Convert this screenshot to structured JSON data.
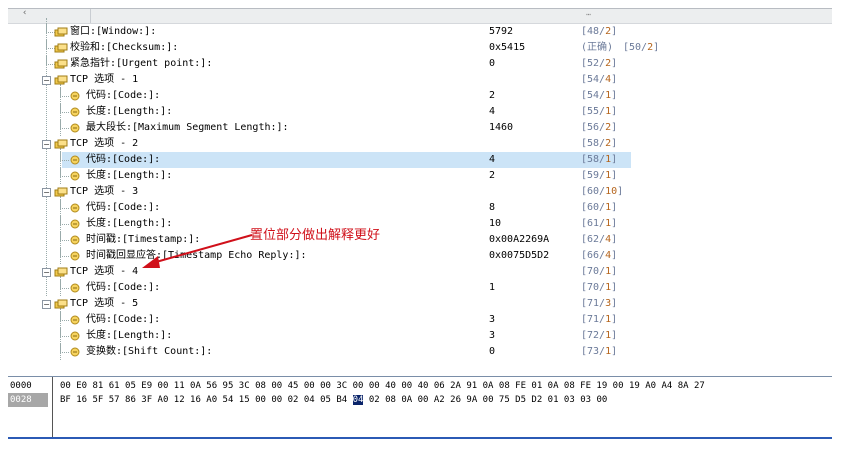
{
  "rows": [
    {
      "label": "窗口:[Window:]:",
      "value": "5792",
      "ref_pre": "[48/",
      "ref_num": "2",
      "ref_post": "]"
    },
    {
      "label": "校验和:[Checksum:]:",
      "value": "0x5415",
      "ref_pre": "(正确)",
      "ref_num": "",
      "ref_post": "",
      "ref2_pre": "[50/",
      "ref2_num": "2",
      "ref2_post": "]"
    },
    {
      "label": "紧急指针:[Urgent point:]:",
      "value": "0",
      "ref_pre": "[52/",
      "ref_num": "2",
      "ref_post": "]"
    },
    {
      "label": "TCP 选项 - 1",
      "value": "",
      "ref_pre": "[54/",
      "ref_num": "4",
      "ref_post": "]"
    },
    {
      "label": "代码:[Code:]:",
      "value": "2",
      "ref_pre": "[54/",
      "ref_num": "1",
      "ref_post": "]"
    },
    {
      "label": "长度:[Length:]:",
      "value": "4",
      "ref_pre": "[55/",
      "ref_num": "1",
      "ref_post": "]"
    },
    {
      "label": "最大段长:[Maximum Segment Length:]:",
      "value": "1460",
      "ref_pre": "[56/",
      "ref_num": "2",
      "ref_post": "]"
    },
    {
      "label": "TCP 选项 - 2",
      "value": "",
      "ref_pre": "[58/",
      "ref_num": "2",
      "ref_post": "]"
    },
    {
      "label": "代码:[Code:]:",
      "value": "4",
      "ref_pre": "[58/",
      "ref_num": "1",
      "ref_post": "]"
    },
    {
      "label": "长度:[Length:]:",
      "value": "2",
      "ref_pre": "[59/",
      "ref_num": "1",
      "ref_post": "]"
    },
    {
      "label": "TCP 选项 - 3",
      "value": "",
      "ref_pre": "[60/",
      "ref_num": "10",
      "ref_post": "]"
    },
    {
      "label": "代码:[Code:]:",
      "value": "8",
      "ref_pre": "[60/",
      "ref_num": "1",
      "ref_post": "]"
    },
    {
      "label": "长度:[Length:]:",
      "value": "10",
      "ref_pre": "[61/",
      "ref_num": "1",
      "ref_post": "]"
    },
    {
      "label": "时间戳:[Timestamp:]:",
      "value": "0x00A2269A",
      "ref_pre": "[62/",
      "ref_num": "4",
      "ref_post": "]"
    },
    {
      "label": "时间戳回显应答:[Timestamp Echo Reply:]:",
      "value": "0x0075D5D2",
      "ref_pre": "[66/",
      "ref_num": "4",
      "ref_post": "]"
    },
    {
      "label": "TCP 选项 - 4",
      "value": "",
      "ref_pre": "[70/",
      "ref_num": "1",
      "ref_post": "]"
    },
    {
      "label": "代码:[Code:]:",
      "value": "1",
      "ref_pre": "[70/",
      "ref_num": "1",
      "ref_post": "]"
    },
    {
      "label": "TCP 选项 - 5",
      "value": "",
      "ref_pre": "[71/",
      "ref_num": "3",
      "ref_post": "]"
    },
    {
      "label": "代码:[Code:]:",
      "value": "3",
      "ref_pre": "[71/",
      "ref_num": "1",
      "ref_post": "]"
    },
    {
      "label": "长度:[Length:]:",
      "value": "3",
      "ref_pre": "[72/",
      "ref_num": "1",
      "ref_post": "]"
    },
    {
      "label": "变换数:[Shift Count:]:",
      "value": "0",
      "ref_pre": "[73/",
      "ref_num": "1",
      "ref_post": "]"
    }
  ],
  "annotation": "置位部分做出解释更好",
  "hex": {
    "row1_offset": "0000",
    "row1_bytes": "00 E0 81 61 05 E9 00 11 0A 56 95 3C 08 00 45 00 00 3C 00 00 40 00 40 06 2A 91 0A 08 FE 01 0A 08 FE 19 00 19 A0 A4 8A 27",
    "row2_offset": "0028",
    "row2_before": "BF 16 5F 57 86 3F A0 12 16 A0 54 15 00 00 02 04 05 B4 ",
    "row2_selected": "04",
    "row2_after": " 02 08 0A 00 A2 26 9A 00 75 D5 D2 01 03 03 00"
  },
  "colors": {
    "selection": "#cce4f7",
    "ref_number": "#b5651d",
    "annotation": "#d0101a",
    "hex_selection": "#0a246a"
  }
}
